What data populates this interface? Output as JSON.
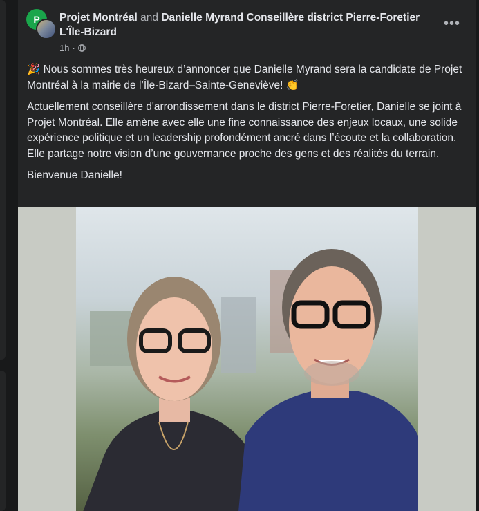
{
  "post": {
    "page_name": "Projet Montréal",
    "conjunction": "and",
    "coauthor": "Danielle Myrand Conseillère district Pierre-Foretier L'Île-Bizard",
    "time": "1h",
    "separator": "·",
    "avatar_letter": "P",
    "more_label": "•••",
    "paragraphs": [
      "🎉 Nous sommes très heureux d’annoncer que Danielle Myrand sera la candidate de Projet Montréal à la mairie de l’Île-Bizard–Sainte-Geneviève! 👏",
      "Actuellement conseillère d'arrondissement dans le district Pierre-Foretier, Danielle se joint à Projet Montréal. Elle amène avec elle une fine connaissance des enjeux locaux, une solide expérience politique et un leadership profondément ancré dans l’écoute et la collaboration. Elle partage notre vision d’une gouvernance proche des gens et des réalités du terrain.",
      "Bienvenue Danielle!"
    ]
  },
  "icons": {
    "privacy": "globe-icon",
    "more": "more-horizontal-icon"
  },
  "colors": {
    "background": "#18191a",
    "card": "#242526",
    "text_primary": "#e4e6eb",
    "text_secondary": "#b0b3b8",
    "brand_green": "#1aa64b"
  }
}
